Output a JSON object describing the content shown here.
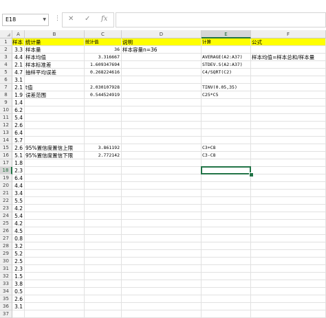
{
  "formula_bar": {
    "name_box": "E18",
    "cancel_icon": "✕",
    "enter_icon": "✓",
    "fx_label": "fx",
    "formula": ""
  },
  "selected_cell": {
    "col": "E",
    "row": 18
  },
  "columns": [
    "A",
    "B",
    "C",
    "D",
    "E",
    "F"
  ],
  "rows": [
    {
      "n": 1,
      "A": "样本",
      "B": "统计量",
      "C": "统计值",
      "D": "说明",
      "E": "计算",
      "F": "公式",
      "yellow": true
    },
    {
      "n": 2,
      "A": "3.3",
      "B": "样本量",
      "C": "36",
      "D": "样本容量n=36",
      "E": "",
      "F": ""
    },
    {
      "n": 3,
      "A": "4.4",
      "B": "样本均值",
      "C": "3.316667",
      "D": "",
      "E": "AVERAGE(A2:A37)",
      "F": "样本均值=样本总和/样本量"
    },
    {
      "n": 4,
      "A": "2.1",
      "B": "样本标准差",
      "C": "1.609347694",
      "D": "",
      "E": "STDEV.S(A2:A37)",
      "F": ""
    },
    {
      "n": 5,
      "A": "4.7",
      "B": "抽样平均误差",
      "C": "0.268224616",
      "D": "",
      "E": "C4/SQRT(C2)",
      "F": ""
    },
    {
      "n": 6,
      "A": "3.1",
      "B": "",
      "C": "",
      "D": "",
      "E": "",
      "F": ""
    },
    {
      "n": 7,
      "A": "2.1",
      "B": "t值",
      "C": "2.030107928",
      "D": "",
      "E": "TINV(0.05,35)",
      "F": ""
    },
    {
      "n": 8,
      "A": "1.9",
      "B": "误差范围",
      "C": "0.544524919",
      "D": "",
      "E": "C25*C5",
      "F": ""
    },
    {
      "n": 9,
      "A": "1.4",
      "B": "",
      "C": "",
      "D": "",
      "E": "",
      "F": ""
    },
    {
      "n": 10,
      "A": "6.2",
      "B": "",
      "C": "",
      "D": "",
      "E": "",
      "F": ""
    },
    {
      "n": 11,
      "A": "5.4",
      "B": "",
      "C": "",
      "D": "",
      "E": "",
      "F": ""
    },
    {
      "n": 12,
      "A": "2.6",
      "B": "",
      "C": "",
      "D": "",
      "E": "",
      "F": ""
    },
    {
      "n": 13,
      "A": "6.4",
      "B": "",
      "C": "",
      "D": "",
      "E": "",
      "F": ""
    },
    {
      "n": 14,
      "A": "5.7",
      "B": "",
      "C": "",
      "D": "",
      "E": "",
      "F": ""
    },
    {
      "n": 15,
      "A": "2.6",
      "B": "95%置信度置信上限",
      "C": "3.861192",
      "D": "",
      "E": "C3+C8",
      "F": ""
    },
    {
      "n": 16,
      "A": "5.1",
      "B": "95%置信度置信下限",
      "C": "2.772142",
      "D": "",
      "E": "C3-C8",
      "F": ""
    },
    {
      "n": 17,
      "A": "1.8",
      "B": "",
      "C": "",
      "D": "",
      "E": "",
      "F": ""
    },
    {
      "n": 18,
      "A": "2.3",
      "B": "",
      "C": "",
      "D": "",
      "E": "",
      "F": ""
    },
    {
      "n": 19,
      "A": "6.4",
      "B": "",
      "C": "",
      "D": "",
      "E": "",
      "F": ""
    },
    {
      "n": 20,
      "A": "4.4",
      "B": "",
      "C": "",
      "D": "",
      "E": "",
      "F": ""
    },
    {
      "n": 21,
      "A": "3.4",
      "B": "",
      "C": "",
      "D": "",
      "E": "",
      "F": ""
    },
    {
      "n": 22,
      "A": "5.5",
      "B": "",
      "C": "",
      "D": "",
      "E": "",
      "F": ""
    },
    {
      "n": 23,
      "A": "4.2",
      "B": "",
      "C": "",
      "D": "",
      "E": "",
      "F": ""
    },
    {
      "n": 24,
      "A": "5.4",
      "B": "",
      "C": "",
      "D": "",
      "E": "",
      "F": ""
    },
    {
      "n": 25,
      "A": "4.2",
      "B": "",
      "C": "",
      "D": "",
      "E": "",
      "F": ""
    },
    {
      "n": 26,
      "A": "4.5",
      "B": "",
      "C": "",
      "D": "",
      "E": "",
      "F": ""
    },
    {
      "n": 27,
      "A": "0.8",
      "B": "",
      "C": "",
      "D": "",
      "E": "",
      "F": ""
    },
    {
      "n": 28,
      "A": "3.2",
      "B": "",
      "C": "",
      "D": "",
      "E": "",
      "F": ""
    },
    {
      "n": 29,
      "A": "5.2",
      "B": "",
      "C": "",
      "D": "",
      "E": "",
      "F": ""
    },
    {
      "n": 30,
      "A": "2.5",
      "B": "",
      "C": "",
      "D": "",
      "E": "",
      "F": ""
    },
    {
      "n": 31,
      "A": "2.3",
      "B": "",
      "C": "",
      "D": "",
      "E": "",
      "F": ""
    },
    {
      "n": 32,
      "A": "1.5",
      "B": "",
      "C": "",
      "D": "",
      "E": "",
      "F": ""
    },
    {
      "n": 33,
      "A": "3.8",
      "B": "",
      "C": "",
      "D": "",
      "E": "",
      "F": ""
    },
    {
      "n": 34,
      "A": "0.5",
      "B": "",
      "C": "",
      "D": "",
      "E": "",
      "F": ""
    },
    {
      "n": 35,
      "A": "2.6",
      "B": "",
      "C": "",
      "D": "",
      "E": "",
      "F": ""
    },
    {
      "n": 36,
      "A": "3.1",
      "B": "",
      "C": "",
      "D": "",
      "E": "",
      "F": ""
    },
    {
      "n": 37,
      "A": "",
      "B": "",
      "C": "",
      "D": "",
      "E": "",
      "F": ""
    }
  ],
  "colors": {
    "header_fill": "#ffff00",
    "selection": "#217346"
  }
}
